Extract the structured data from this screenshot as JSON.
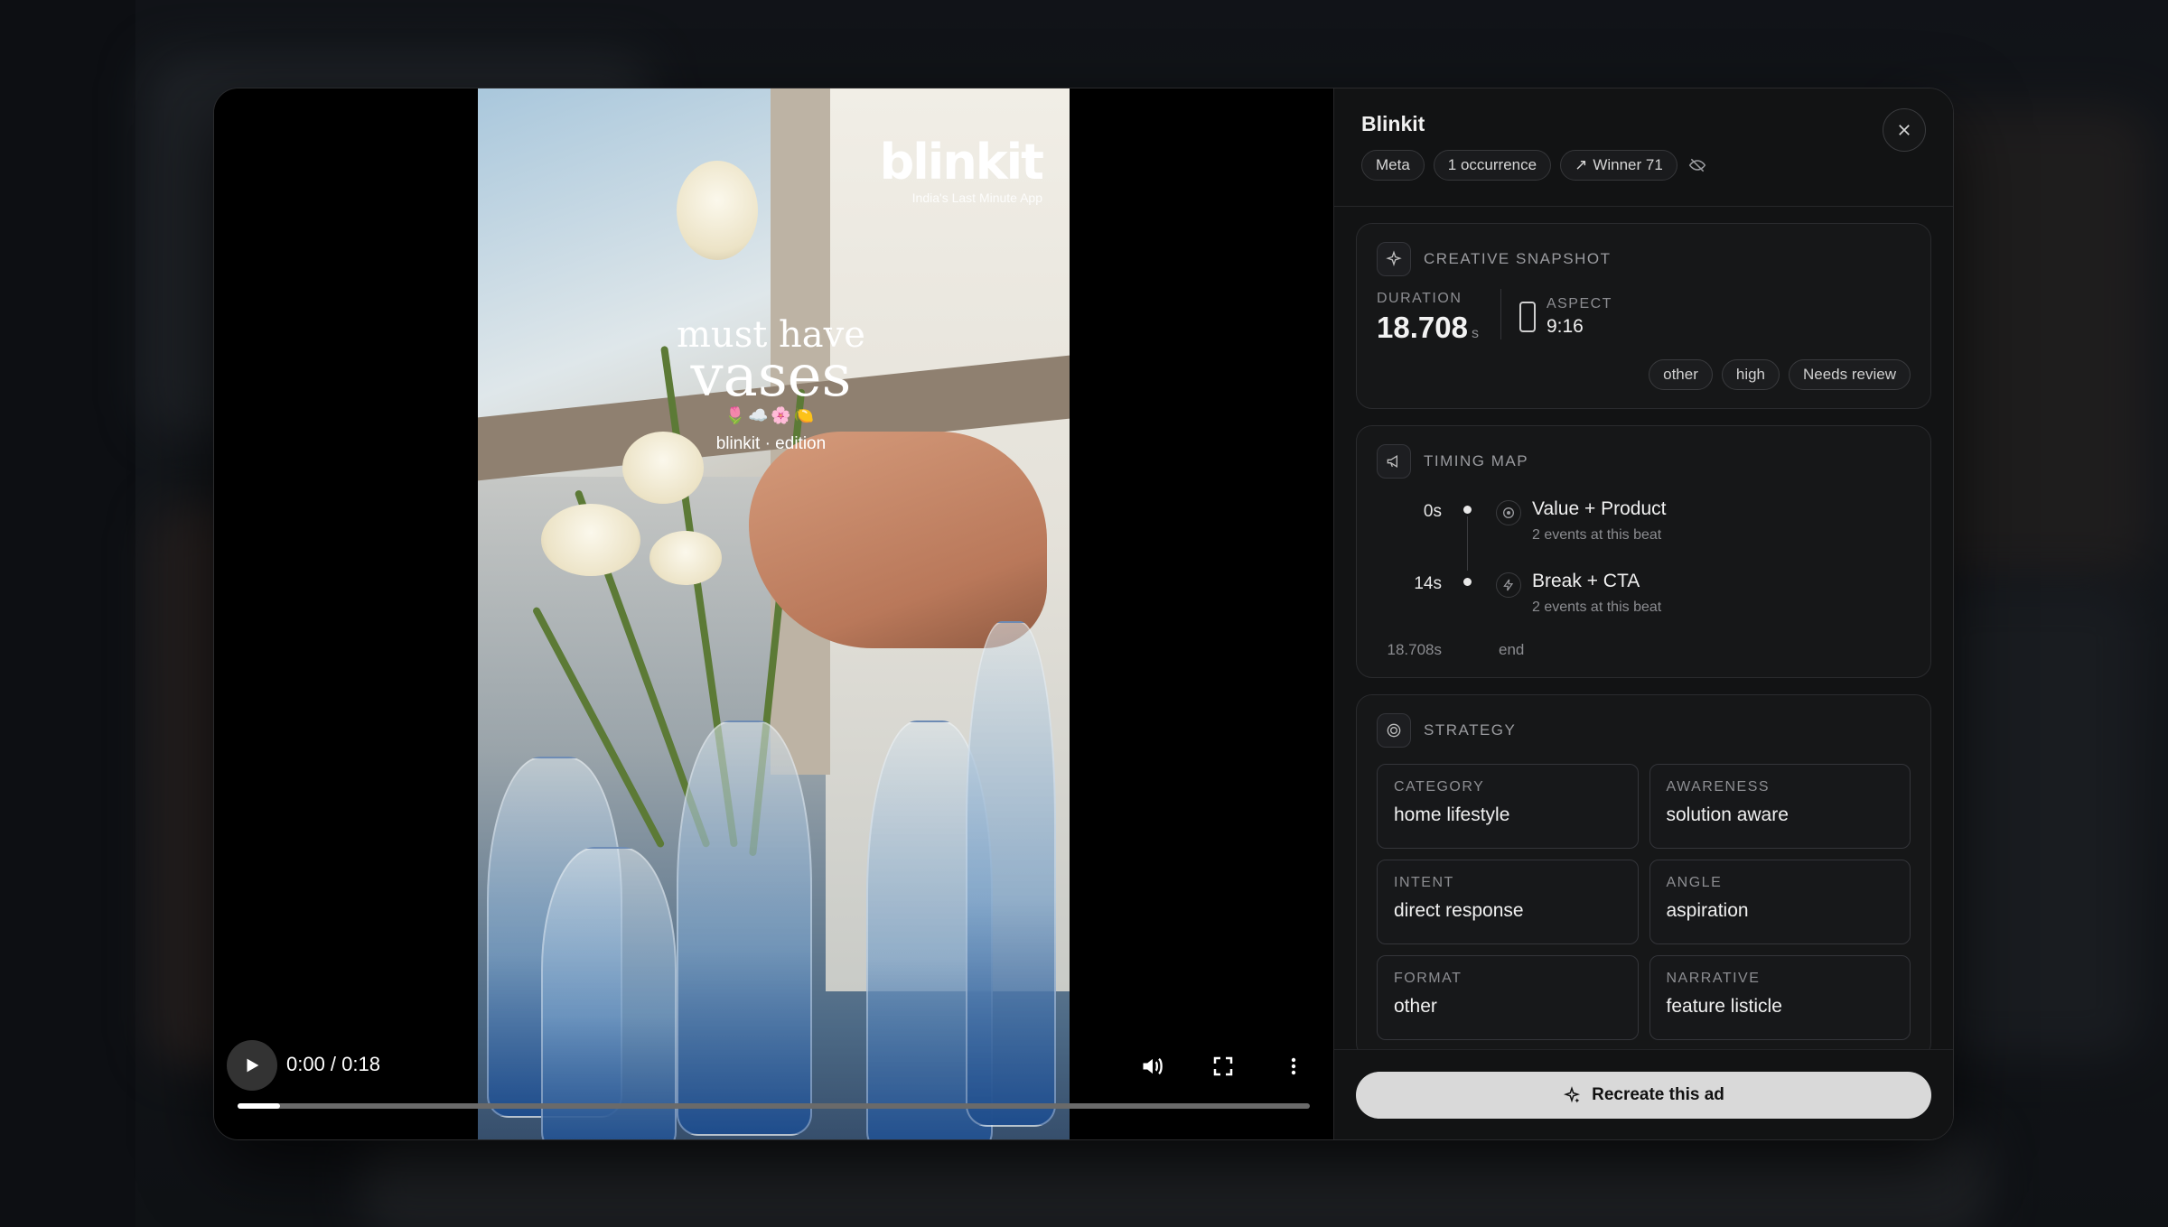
{
  "video": {
    "brand_logo": "blinkit",
    "brand_tagline": "India's Last Minute App",
    "overlay_line1": "must have",
    "overlay_line2": "vases",
    "overlay_emoji": "🌷☁️🌸🍋",
    "overlay_edition": "blinkit · edition",
    "time_display": "0:00 / 0:18",
    "progress_fraction": 0.04
  },
  "panel": {
    "title": "Blinkit",
    "chips": {
      "platform": "Meta",
      "occurrences": "1 occurrence",
      "winner": "Winner 71"
    }
  },
  "snapshot": {
    "title": "CREATIVE SNAPSHOT",
    "duration_label": "DURATION",
    "duration_value": "18.708",
    "duration_unit": "s",
    "aspect_label": "ASPECT",
    "aspect_value": "9:16",
    "tags": [
      "other",
      "high",
      "Needs review"
    ]
  },
  "timing": {
    "title": "TIMING MAP",
    "beats": [
      {
        "time": "0s",
        "title": "Value + Product",
        "sub": "2 events at this beat",
        "icon": "target-icon"
      },
      {
        "time": "14s",
        "title": "Break + CTA",
        "sub": "2 events at this beat",
        "icon": "bolt-icon"
      }
    ],
    "end_time": "18.708s",
    "end_label": "end"
  },
  "strategy": {
    "title": "STRATEGY",
    "cells": [
      {
        "label": "CATEGORY",
        "value": "home lifestyle"
      },
      {
        "label": "AWARENESS",
        "value": "solution aware"
      },
      {
        "label": "INTENT",
        "value": "direct response"
      },
      {
        "label": "ANGLE",
        "value": "aspiration"
      },
      {
        "label": "FORMAT",
        "value": "other"
      },
      {
        "label": "NARRATIVE",
        "value": "feature listicle"
      }
    ]
  },
  "footer": {
    "recreate_label": "Recreate this ad"
  },
  "colors": {
    "modal_bg": "#0e0f10",
    "panel_bg": "#121314",
    "button_bg": "#d9d9d9"
  }
}
